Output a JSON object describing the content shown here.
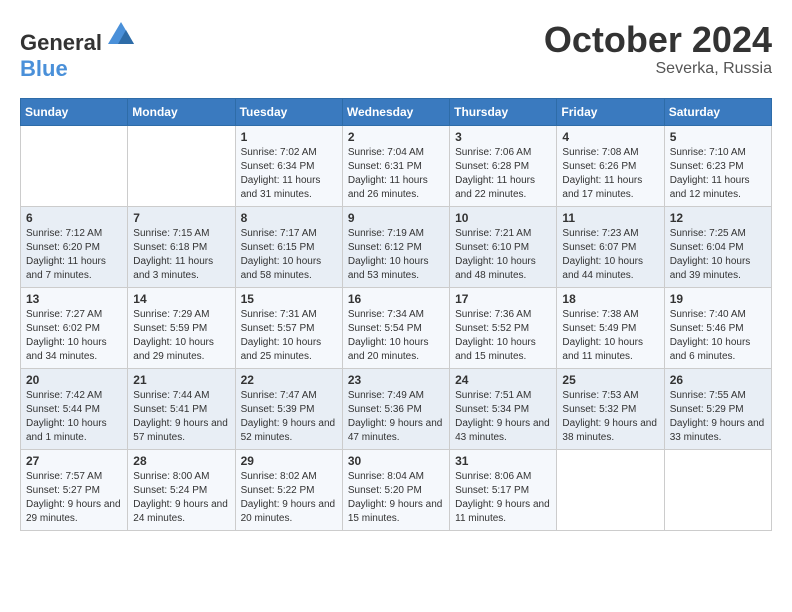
{
  "header": {
    "logo_general": "General",
    "logo_blue": "Blue",
    "month": "October 2024",
    "location": "Severka, Russia"
  },
  "weekdays": [
    "Sunday",
    "Monday",
    "Tuesday",
    "Wednesday",
    "Thursday",
    "Friday",
    "Saturday"
  ],
  "weeks": [
    [
      {
        "day": "",
        "info": ""
      },
      {
        "day": "",
        "info": ""
      },
      {
        "day": "1",
        "info": "Sunrise: 7:02 AM\nSunset: 6:34 PM\nDaylight: 11 hours and 31 minutes."
      },
      {
        "day": "2",
        "info": "Sunrise: 7:04 AM\nSunset: 6:31 PM\nDaylight: 11 hours and 26 minutes."
      },
      {
        "day": "3",
        "info": "Sunrise: 7:06 AM\nSunset: 6:28 PM\nDaylight: 11 hours and 22 minutes."
      },
      {
        "day": "4",
        "info": "Sunrise: 7:08 AM\nSunset: 6:26 PM\nDaylight: 11 hours and 17 minutes."
      },
      {
        "day": "5",
        "info": "Sunrise: 7:10 AM\nSunset: 6:23 PM\nDaylight: 11 hours and 12 minutes."
      }
    ],
    [
      {
        "day": "6",
        "info": "Sunrise: 7:12 AM\nSunset: 6:20 PM\nDaylight: 11 hours and 7 minutes."
      },
      {
        "day": "7",
        "info": "Sunrise: 7:15 AM\nSunset: 6:18 PM\nDaylight: 11 hours and 3 minutes."
      },
      {
        "day": "8",
        "info": "Sunrise: 7:17 AM\nSunset: 6:15 PM\nDaylight: 10 hours and 58 minutes."
      },
      {
        "day": "9",
        "info": "Sunrise: 7:19 AM\nSunset: 6:12 PM\nDaylight: 10 hours and 53 minutes."
      },
      {
        "day": "10",
        "info": "Sunrise: 7:21 AM\nSunset: 6:10 PM\nDaylight: 10 hours and 48 minutes."
      },
      {
        "day": "11",
        "info": "Sunrise: 7:23 AM\nSunset: 6:07 PM\nDaylight: 10 hours and 44 minutes."
      },
      {
        "day": "12",
        "info": "Sunrise: 7:25 AM\nSunset: 6:04 PM\nDaylight: 10 hours and 39 minutes."
      }
    ],
    [
      {
        "day": "13",
        "info": "Sunrise: 7:27 AM\nSunset: 6:02 PM\nDaylight: 10 hours and 34 minutes."
      },
      {
        "day": "14",
        "info": "Sunrise: 7:29 AM\nSunset: 5:59 PM\nDaylight: 10 hours and 29 minutes."
      },
      {
        "day": "15",
        "info": "Sunrise: 7:31 AM\nSunset: 5:57 PM\nDaylight: 10 hours and 25 minutes."
      },
      {
        "day": "16",
        "info": "Sunrise: 7:34 AM\nSunset: 5:54 PM\nDaylight: 10 hours and 20 minutes."
      },
      {
        "day": "17",
        "info": "Sunrise: 7:36 AM\nSunset: 5:52 PM\nDaylight: 10 hours and 15 minutes."
      },
      {
        "day": "18",
        "info": "Sunrise: 7:38 AM\nSunset: 5:49 PM\nDaylight: 10 hours and 11 minutes."
      },
      {
        "day": "19",
        "info": "Sunrise: 7:40 AM\nSunset: 5:46 PM\nDaylight: 10 hours and 6 minutes."
      }
    ],
    [
      {
        "day": "20",
        "info": "Sunrise: 7:42 AM\nSunset: 5:44 PM\nDaylight: 10 hours and 1 minute."
      },
      {
        "day": "21",
        "info": "Sunrise: 7:44 AM\nSunset: 5:41 PM\nDaylight: 9 hours and 57 minutes."
      },
      {
        "day": "22",
        "info": "Sunrise: 7:47 AM\nSunset: 5:39 PM\nDaylight: 9 hours and 52 minutes."
      },
      {
        "day": "23",
        "info": "Sunrise: 7:49 AM\nSunset: 5:36 PM\nDaylight: 9 hours and 47 minutes."
      },
      {
        "day": "24",
        "info": "Sunrise: 7:51 AM\nSunset: 5:34 PM\nDaylight: 9 hours and 43 minutes."
      },
      {
        "day": "25",
        "info": "Sunrise: 7:53 AM\nSunset: 5:32 PM\nDaylight: 9 hours and 38 minutes."
      },
      {
        "day": "26",
        "info": "Sunrise: 7:55 AM\nSunset: 5:29 PM\nDaylight: 9 hours and 33 minutes."
      }
    ],
    [
      {
        "day": "27",
        "info": "Sunrise: 7:57 AM\nSunset: 5:27 PM\nDaylight: 9 hours and 29 minutes."
      },
      {
        "day": "28",
        "info": "Sunrise: 8:00 AM\nSunset: 5:24 PM\nDaylight: 9 hours and 24 minutes."
      },
      {
        "day": "29",
        "info": "Sunrise: 8:02 AM\nSunset: 5:22 PM\nDaylight: 9 hours and 20 minutes."
      },
      {
        "day": "30",
        "info": "Sunrise: 8:04 AM\nSunset: 5:20 PM\nDaylight: 9 hours and 15 minutes."
      },
      {
        "day": "31",
        "info": "Sunrise: 8:06 AM\nSunset: 5:17 PM\nDaylight: 9 hours and 11 minutes."
      },
      {
        "day": "",
        "info": ""
      },
      {
        "day": "",
        "info": ""
      }
    ]
  ]
}
